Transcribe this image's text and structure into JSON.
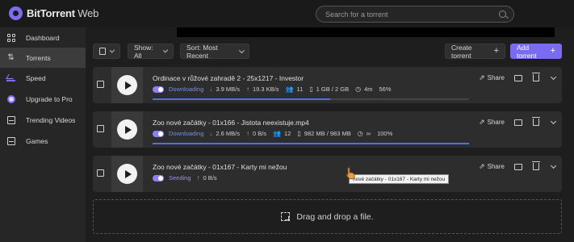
{
  "app": {
    "brand": "BitTorrent",
    "brand_suffix": " Web"
  },
  "search": {
    "placeholder": "Search for a torrent"
  },
  "sidebar": {
    "items": [
      {
        "label": "Dashboard",
        "icon": "grid-icon"
      },
      {
        "label": "Torrents",
        "icon": "arrows-icon",
        "active": true
      },
      {
        "label": "Speed",
        "icon": "speed-icon"
      },
      {
        "label": "Upgrade to Pro",
        "icon": "pro-icon"
      },
      {
        "label": "Trending Videos",
        "icon": "video-icon"
      },
      {
        "label": "Games",
        "icon": "games-icon"
      }
    ]
  },
  "toolbar": {
    "show_label": "Show: All",
    "sort_label": "Sort: Most Recent",
    "create_label": "Create torrent",
    "add_label": "Add torrent"
  },
  "torrents": [
    {
      "title": "Ordinace v růžové zahradě 2 - 25x1217 - Investor",
      "status": "Downloading",
      "down_speed": "3.9 MB/s",
      "up_speed": "19.3 KB/s",
      "peers": "11",
      "size": "1 GB / 2 GB",
      "eta": "4m",
      "percent": "56%",
      "progress_value": 0.56
    },
    {
      "title": "Zoo nové začátky - 01x166 - Jistota neexistuje.mp4",
      "status": "Downloading",
      "down_speed": "2.6 MB/s",
      "up_speed": "0 B/s",
      "peers": "12",
      "size": "982 MB / 983 MB",
      "eta": "∞",
      "percent": "100%",
      "progress_value": 1.0
    },
    {
      "title": "Zoo nové začátky - 01x167 - Karty mi nežou",
      "status": "Seeding",
      "up_speed": "0 B/s"
    }
  ],
  "actions": {
    "share_label": "Share"
  },
  "dropzone": {
    "label": "Drag and drop a file."
  },
  "tooltip": {
    "text": "nové začátky - 01x167 - Karty mi nežou"
  },
  "colors": {
    "accent": "#7a6cf0",
    "download": "#6d8ff5",
    "upload": "#8fd24a"
  }
}
